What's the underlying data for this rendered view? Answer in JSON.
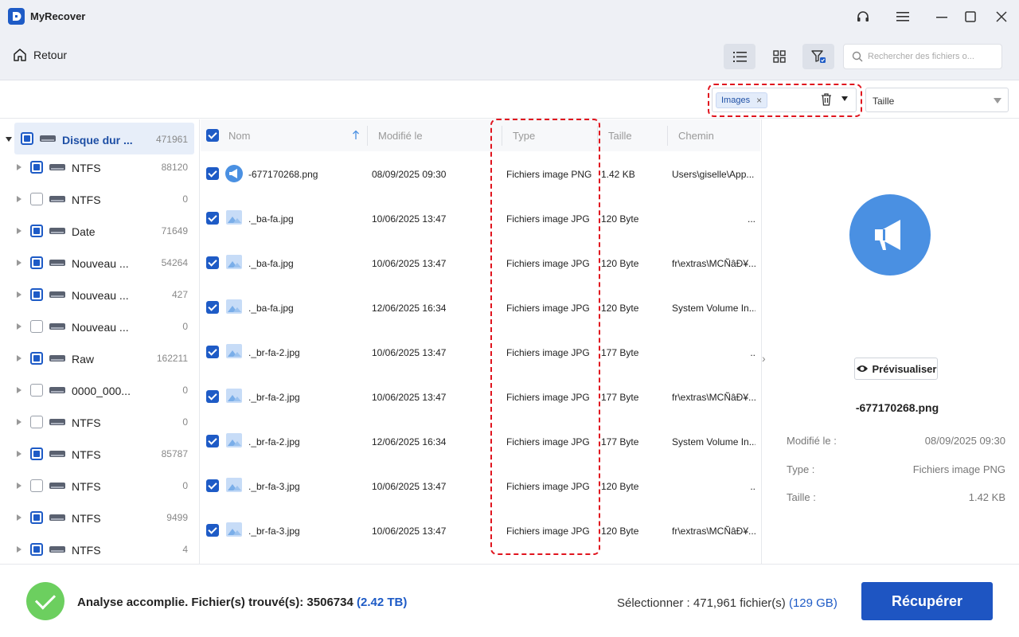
{
  "app": {
    "title": "MyRecover"
  },
  "toolbar": {
    "back_label": "Retour",
    "search_placeholder": "Rechercher des fichiers o..."
  },
  "filter": {
    "chip_label": "Images",
    "chip_close": "×",
    "size_label": "Taille"
  },
  "tree": {
    "root": {
      "label": "Disque dur ...",
      "count": "471961"
    },
    "items": [
      {
        "label": "NTFS",
        "count": "88120",
        "checked": true
      },
      {
        "label": "NTFS",
        "count": "0",
        "checked": false
      },
      {
        "label": "Date",
        "count": "71649",
        "checked": true
      },
      {
        "label": "Nouveau ...",
        "count": "54264",
        "checked": true
      },
      {
        "label": "Nouveau ...",
        "count": "427",
        "checked": true
      },
      {
        "label": "Nouveau ...",
        "count": "0",
        "checked": false
      },
      {
        "label": "Raw",
        "count": "162211",
        "checked": true
      },
      {
        "label": "0000_000...",
        "count": "0",
        "checked": false
      },
      {
        "label": "NTFS",
        "count": "0",
        "checked": false
      },
      {
        "label": "NTFS",
        "count": "85787",
        "checked": true
      },
      {
        "label": "NTFS",
        "count": "0",
        "checked": false
      },
      {
        "label": "NTFS",
        "count": "9499",
        "checked": true
      },
      {
        "label": "NTFS",
        "count": "4",
        "checked": true
      }
    ]
  },
  "list": {
    "headers": {
      "name": "Nom",
      "modified": "Modifié le",
      "type": "Type",
      "size": "Taille",
      "path": "Chemin"
    },
    "rows": [
      {
        "name": "-677170268.png",
        "modified": "08/09/2025 09:30",
        "type": "Fichiers image PNG",
        "size": "1.42 KB",
        "path": "Users\\giselle\\App...",
        "icon": "megaphone-icon"
      },
      {
        "name": "._ba-fa.jpg",
        "modified": "10/06/2025 13:47",
        "type": "Fichiers image JPG",
        "size": "120 Byte",
        "path": "...",
        "icon": "image-icon"
      },
      {
        "name": "._ba-fa.jpg",
        "modified": "10/06/2025 13:47",
        "type": "Fichiers image JPG",
        "size": "120 Byte",
        "path": "fr\\extras\\MCÑâĐ¥...",
        "icon": "image-icon"
      },
      {
        "name": "._ba-fa.jpg",
        "modified": "12/06/2025 16:34",
        "type": "Fichiers image JPG",
        "size": "120 Byte",
        "path": "System Volume In...",
        "icon": "image-icon"
      },
      {
        "name": "._br-fa-2.jpg",
        "modified": "10/06/2025 13:47",
        "type": "Fichiers image JPG",
        "size": "177 Byte",
        "path": "..",
        "icon": "image-icon"
      },
      {
        "name": "._br-fa-2.jpg",
        "modified": "10/06/2025 13:47",
        "type": "Fichiers image JPG",
        "size": "177 Byte",
        "path": "fr\\extras\\MCÑâĐ¥...",
        "icon": "image-icon"
      },
      {
        "name": "._br-fa-2.jpg",
        "modified": "12/06/2025 16:34",
        "type": "Fichiers image JPG",
        "size": "177 Byte",
        "path": "System Volume In...",
        "icon": "image-icon"
      },
      {
        "name": "._br-fa-3.jpg",
        "modified": "10/06/2025 13:47",
        "type": "Fichiers image JPG",
        "size": "120 Byte",
        "path": "..",
        "icon": "image-icon"
      },
      {
        "name": "._br-fa-3.jpg",
        "modified": "10/06/2025 13:47",
        "type": "Fichiers image JPG",
        "size": "120 Byte",
        "path": "fr\\extras\\MCÑâĐ¥...",
        "icon": "image-icon"
      }
    ]
  },
  "preview": {
    "button_label": "Prévisualiser",
    "file_name": "-677170268.png",
    "modified_label": "Modifié le :",
    "modified_value": "08/09/2025 09:30",
    "type_label": "Type :",
    "type_value": "Fichiers image PNG",
    "size_label": "Taille :",
    "size_value": "1.42 KB"
  },
  "status": {
    "text": "Analyse accomplie. Fichier(s) trouvé(s): 3506734",
    "size": "(2.42 TB)",
    "select_text": "Sélectionner : 471,961 fichier(s)",
    "select_size": "(129 GB)",
    "recover_label": "Récupérer"
  },
  "colors": {
    "accent": "#1e5bc6",
    "highlight": "#e0141e",
    "success": "#6ccf5f"
  }
}
